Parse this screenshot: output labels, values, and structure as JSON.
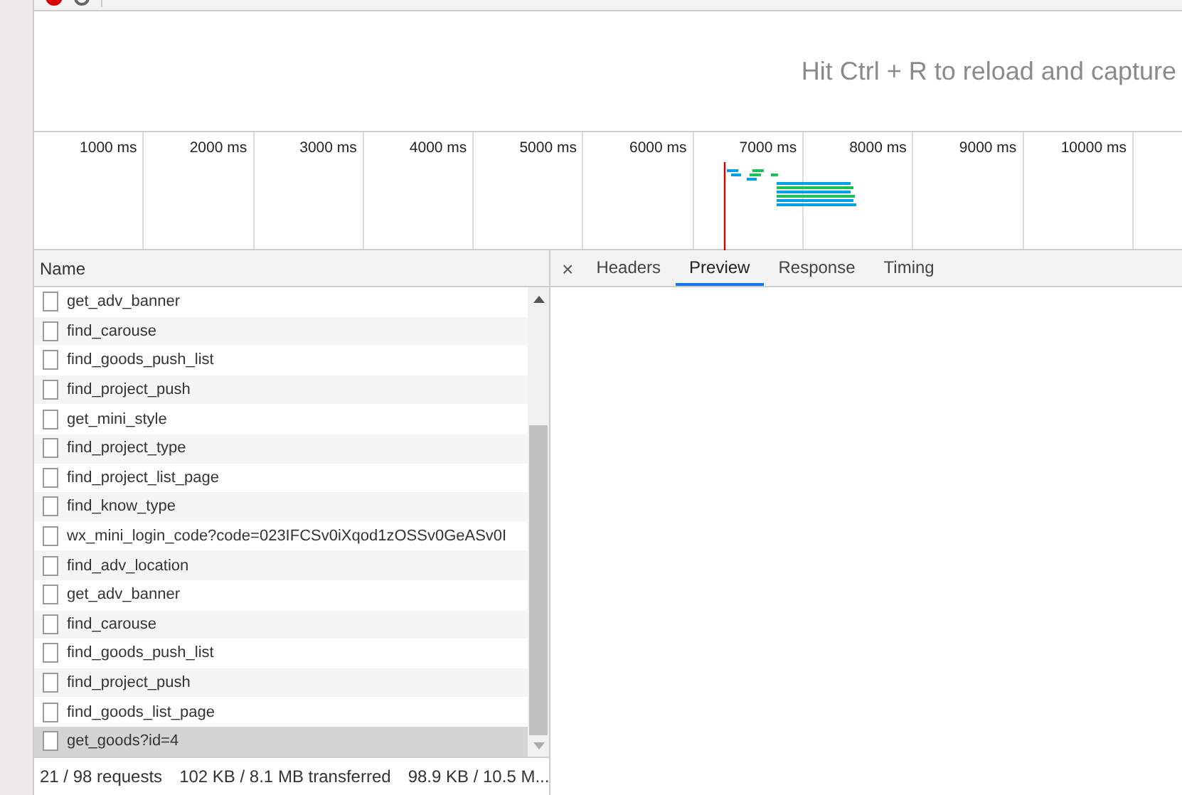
{
  "hint": "Hit Ctrl + R to reload and capture",
  "overview": {
    "ticks": [
      "1000 ms",
      "2000 ms",
      "3000 ms",
      "4000 ms",
      "5000 ms",
      "6000 ms",
      "7000 ms",
      "8000 ms",
      "9000 ms",
      "10000 ms"
    ]
  },
  "requests": {
    "column": "Name",
    "rows": [
      {
        "name": "get_adv_banner",
        "selected": false
      },
      {
        "name": "find_carouse",
        "selected": false
      },
      {
        "name": "find_goods_push_list",
        "selected": false
      },
      {
        "name": "find_project_push",
        "selected": false
      },
      {
        "name": "get_mini_style",
        "selected": false
      },
      {
        "name": "find_project_type",
        "selected": false
      },
      {
        "name": "find_project_list_page",
        "selected": false
      },
      {
        "name": "find_know_type",
        "selected": false
      },
      {
        "name": "wx_mini_login_code?code=023IFCSv0iXqod1zOSSv0GeASv0I",
        "selected": false
      },
      {
        "name": "find_adv_location",
        "selected": false
      },
      {
        "name": "get_adv_banner",
        "selected": false
      },
      {
        "name": "find_carouse",
        "selected": false
      },
      {
        "name": "find_goods_push_list",
        "selected": false
      },
      {
        "name": "find_project_push",
        "selected": false
      },
      {
        "name": "find_goods_list_page",
        "selected": false
      },
      {
        "name": "get_goods?id=4",
        "selected": true
      }
    ]
  },
  "detail": {
    "close": "×",
    "tabs": [
      {
        "label": "Headers",
        "selected": false
      },
      {
        "label": "Preview",
        "selected": true
      },
      {
        "label": "Response",
        "selected": false
      },
      {
        "label": "Timing",
        "selected": false
      }
    ]
  },
  "status_bar": [
    "21 / 98 requests",
    "102 KB / 8.1 MB transferred",
    "98.9 KB / 10.5 M..."
  ]
}
